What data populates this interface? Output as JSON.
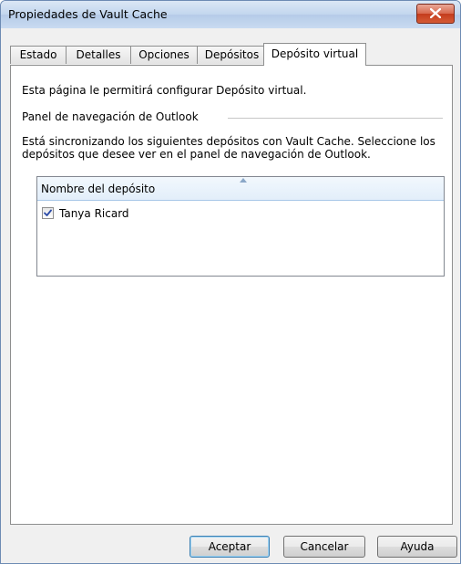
{
  "window": {
    "title": "Propiedades de Vault Cache"
  },
  "tabs": [
    {
      "label": "Estado"
    },
    {
      "label": "Detalles"
    },
    {
      "label": "Opciones"
    },
    {
      "label": "Depósitos"
    },
    {
      "label": "Depósito virtual",
      "active": true
    }
  ],
  "panel": {
    "intro": "Esta página le permitirá configurar Depósito virtual.",
    "group_title": "Panel de navegación de Outlook",
    "description": "Está sincronizando los siguientes depósitos con Vault Cache. Seleccione los depósitos que desee ver en el panel de navegación de Outlook.",
    "list": {
      "column_header": "Nombre del depósito",
      "sort": "ascending",
      "rows": [
        {
          "label": "Tanya Ricard",
          "checked": true
        }
      ]
    }
  },
  "buttons": {
    "ok": "Aceptar",
    "cancel": "Cancelar",
    "help": "Ayuda"
  },
  "colors": {
    "titlebar": "#c2d6ee",
    "close_button": "#c43c1d",
    "header_bg": "#e2eefa",
    "checkmark": "#2b4aa8"
  }
}
